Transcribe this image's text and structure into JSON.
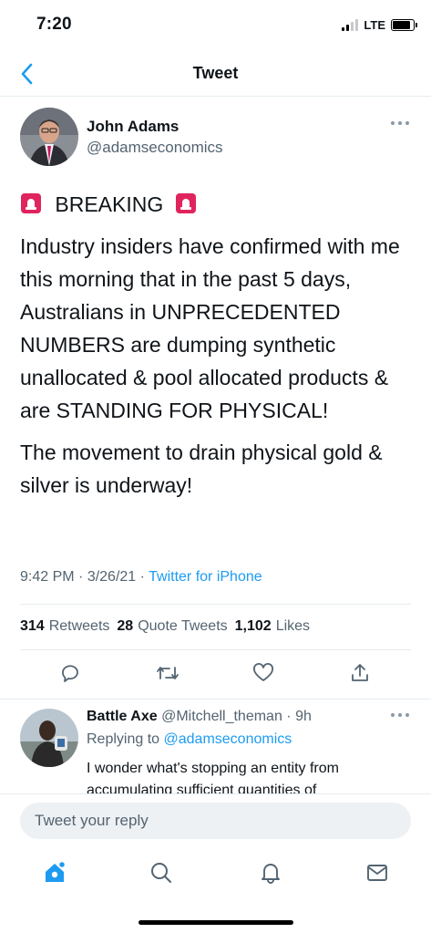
{
  "status_bar": {
    "time": "7:20",
    "network": "LTE",
    "battery_level": 0.85
  },
  "nav": {
    "title": "Tweet"
  },
  "tweet": {
    "author_name": "John Adams",
    "author_handle": "@adamseconomics",
    "paragraphs": {
      "breaking": "BREAKING",
      "p1": "Industry insiders have confirmed with me this morning that in the past 5 days, Australians in UNPRECEDENTED NUMBERS are dumping synthetic unallocated & pool allocated products & are STANDING FOR PHYSICAL!",
      "p2": "The movement to drain physical gold & silver is underway!"
    },
    "time": "9:42 PM",
    "date": "3/26/21",
    "source": "Twitter for iPhone",
    "stats": {
      "retweets_count": "314",
      "retweets_label": "Retweets",
      "quotes_count": "28",
      "quotes_label": "Quote Tweets",
      "likes_count": "1,102",
      "likes_label": "Likes"
    }
  },
  "reply": {
    "name": "Battle Axe",
    "handle": "@Mitchell_theman",
    "time": "9h",
    "replying_label": "Replying to",
    "replying_to": "@adamseconomics",
    "text": "I wonder what's stopping an entity from accumulating sufficient quantities of"
  },
  "compose": {
    "placeholder": "Tweet your reply"
  },
  "tabs": [
    "home-icon",
    "search-icon",
    "notifications-icon",
    "messages-icon"
  ],
  "colors": {
    "accent": "#1d9bf0",
    "siren": "#e0245e",
    "text": "#0f1419",
    "muted": "#536471"
  }
}
